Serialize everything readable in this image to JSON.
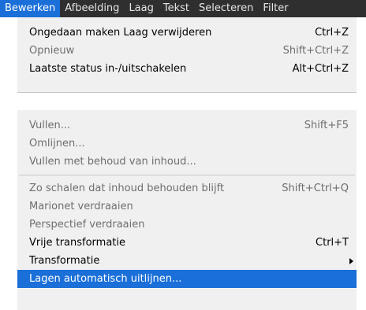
{
  "menubar": {
    "items": [
      "Bewerken",
      "Afbeelding",
      "Laag",
      "Tekst",
      "Selecteren",
      "Filter"
    ]
  },
  "menu1": {
    "items": [
      {
        "label": "Ongedaan maken Laag verwijderen",
        "shortcut": "Ctrl+Z",
        "enabled": true
      },
      {
        "label": "Opnieuw",
        "shortcut": "Shift+Ctrl+Z",
        "enabled": false
      },
      {
        "label": "Laatste status in-/uitschakelen",
        "shortcut": "Alt+Ctrl+Z",
        "enabled": true
      }
    ]
  },
  "menu2": {
    "items": [
      {
        "label": "Vullen...",
        "shortcut": "Shift+F5",
        "enabled": false
      },
      {
        "label": "Omlijnen...",
        "shortcut": "",
        "enabled": false
      },
      {
        "label": "Vullen met behoud van inhoud...",
        "shortcut": "",
        "enabled": false
      },
      {
        "label": "Zo schalen dat inhoud behouden blijft",
        "shortcut": "Shift+Ctrl+Q",
        "enabled": false
      },
      {
        "label": "Marionet verdraaien",
        "shortcut": "",
        "enabled": false
      },
      {
        "label": "Perspectief verdraaien",
        "shortcut": "",
        "enabled": false
      },
      {
        "label": "Vrije transformatie",
        "shortcut": "Ctrl+T",
        "enabled": true
      },
      {
        "label": "Transformatie",
        "shortcut": "",
        "enabled": true,
        "submenu": true
      },
      {
        "label": "Lagen automatisch uitlijnen...",
        "shortcut": "",
        "enabled": true,
        "highlighted": true
      }
    ]
  }
}
